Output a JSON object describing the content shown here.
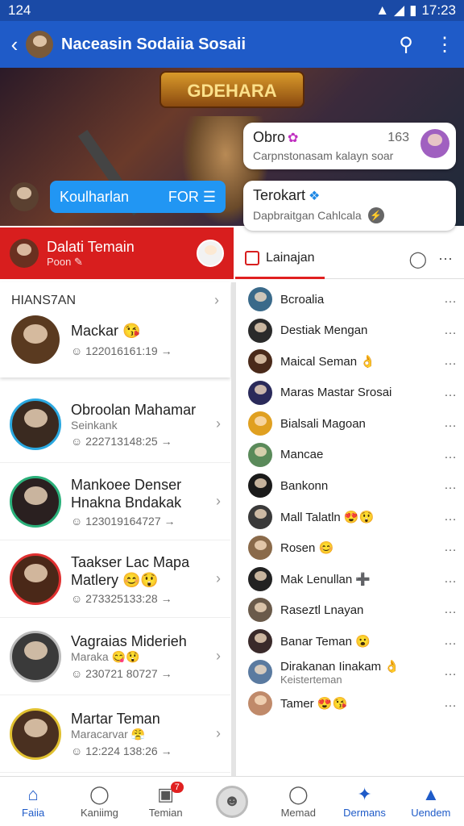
{
  "status": {
    "time_left": "124",
    "time_right": "17:23",
    "icons": [
      "wifi-icon",
      "signal-icon",
      "battery-icon"
    ]
  },
  "appbar": {
    "title": "Naceasin Sodaiia Sosaii",
    "back_icon": "back-arrow-icon",
    "search_icon": "search-icon",
    "more_icon": "more-vert-icon"
  },
  "hero": {
    "banner": "GDEHARA",
    "card1": {
      "title": "Obro",
      "count": "163",
      "sub": "Carpnstonasam kalayn soar"
    },
    "card2": {
      "title": "Terokart",
      "sub": "Dapbraitgan Cahlcala"
    },
    "pill": {
      "label": "Koulharlan",
      "right": "FOR ☰"
    }
  },
  "redbar": {
    "name": "Dalati Temain",
    "sub": "Poon ✎"
  },
  "left": {
    "section_label": "HIANS7AN",
    "featured": {
      "name": "Mackar 😘",
      "meta": "☺ 122016161:19 →"
    },
    "items": [
      {
        "name": "Obroolan Mahamar",
        "sub": "Seinkank",
        "meta": "☺ 222713148:25 →"
      },
      {
        "name": "Mankoee Denser Hnakna Bndakak",
        "sub": "",
        "meta": "☺ 123019164727 →"
      },
      {
        "name": "Taakser Lac Mapa Matlery 😊😲",
        "sub": "",
        "meta": "☺ 273325133:28 →"
      },
      {
        "name": "Vagraias Miderieh",
        "sub": "Maraka 😋😲",
        "meta": "☺ 230721 80727 →"
      },
      {
        "name": "Martar Teman",
        "sub": "Maracarvar 😤",
        "meta": "☺ 12:224 138:26 →"
      }
    ]
  },
  "right": {
    "tab_label": "Lainajan",
    "items": [
      "Bcroalia",
      "Destiak Mengan",
      "Maical Seman 👌",
      "Maras Mastar Srosai",
      "Bialsali Magoan",
      "Mancae",
      "Bankonn",
      "Mall Talatln 😍😲",
      "Rosen 😊",
      "Mak Lenullan ➕",
      "Raseztl Lnayan",
      "Banar Teman 😮",
      "Dirakanan Iinakam 👌",
      "Tamer 😍😘"
    ],
    "item13_sub": "Keisterteman"
  },
  "nav": {
    "items": [
      {
        "label": "Faiia",
        "icon": "home-icon"
      },
      {
        "label": "Kaniimg",
        "icon": "chat-icon"
      },
      {
        "label": "Temian",
        "icon": "store-icon",
        "badge": "7"
      },
      {
        "label": "",
        "icon": "center-avatar"
      },
      {
        "label": "Memad",
        "icon": "messenger-icon"
      },
      {
        "label": "Dermans",
        "icon": "twitter-bird-icon"
      },
      {
        "label": "Uendem",
        "icon": "profile-icon"
      }
    ]
  }
}
